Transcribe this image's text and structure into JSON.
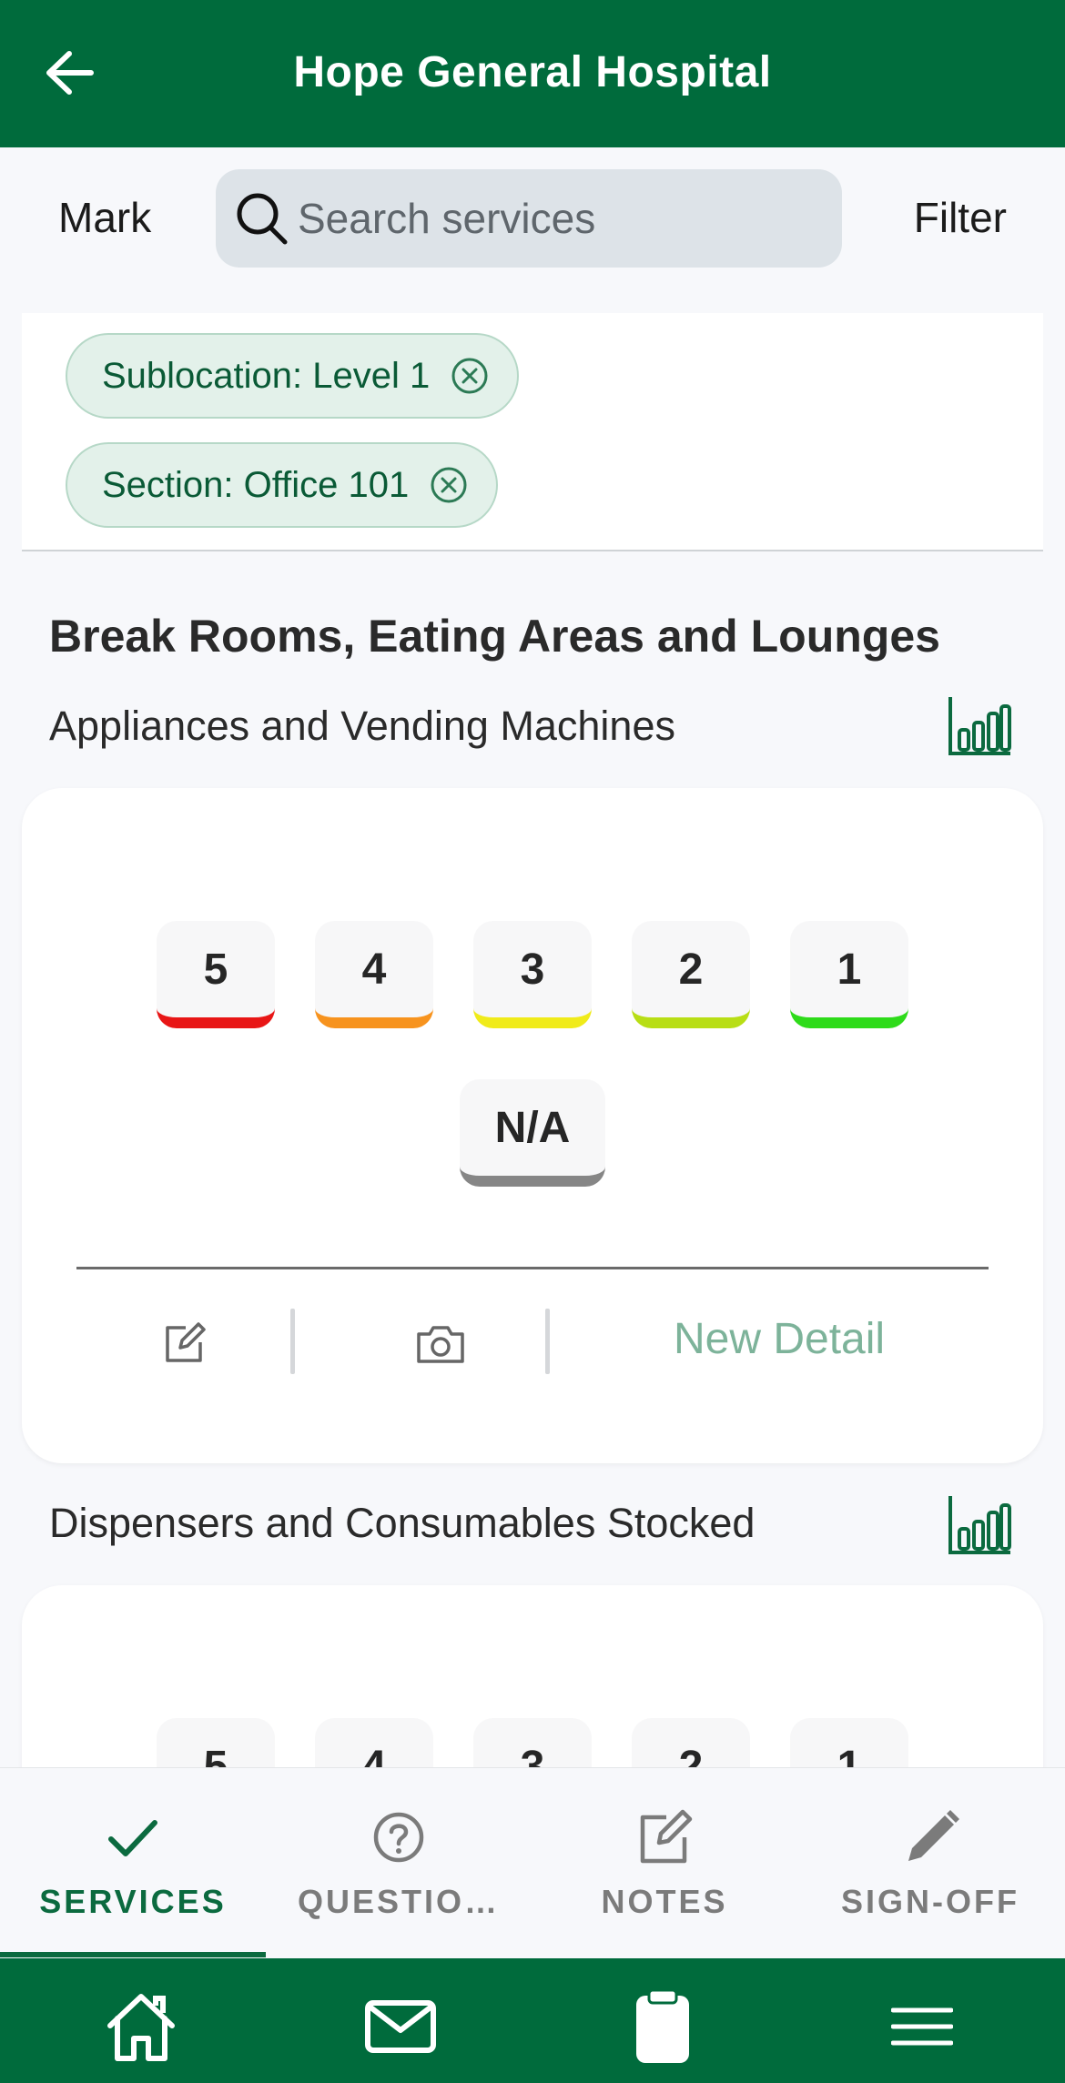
{
  "header": {
    "title": "Hope General Hospital"
  },
  "toolbar": {
    "mark_label": "Mark",
    "filter_label": "Filter"
  },
  "search": {
    "placeholder": "Search services",
    "value": ""
  },
  "filters": [
    {
      "label": "Sublocation: Level 1"
    },
    {
      "label": "Section: Office 101"
    }
  ],
  "section": {
    "title": "Break Rooms, Eating Areas and Lounges"
  },
  "items": [
    {
      "label": "Appliances and Vending Machines"
    },
    {
      "label": "Dispensers and Consumables Stocked"
    }
  ],
  "ratings": [
    {
      "label": "5",
      "color": "#e81616"
    },
    {
      "label": "4",
      "color": "#f7931e"
    },
    {
      "label": "3",
      "color": "#f0eb1a"
    },
    {
      "label": "2",
      "color": "#b8de15"
    },
    {
      "label": "1",
      "color": "#2edb1a"
    },
    {
      "label": "N/A",
      "color": "#868686"
    }
  ],
  "card_actions": {
    "new_detail_label": "New Detail"
  },
  "tabs": [
    {
      "label": "SERVICES",
      "icon": "check-icon",
      "active": true
    },
    {
      "label": "QUESTIO…",
      "icon": "question-circle-icon",
      "active": false
    },
    {
      "label": "NOTES",
      "icon": "edit-note-icon",
      "active": false
    },
    {
      "label": "SIGN-OFF",
      "icon": "pencil-icon",
      "active": false
    }
  ],
  "bottom_nav": [
    {
      "icon": "home-icon"
    },
    {
      "icon": "mail-icon"
    },
    {
      "icon": "clipboard-icon"
    },
    {
      "icon": "menu-icon"
    }
  ],
  "colors": {
    "brand_green": "#006b3c",
    "chip_bg": "#e3f1ea",
    "accent_light_green": "#7db39a"
  }
}
